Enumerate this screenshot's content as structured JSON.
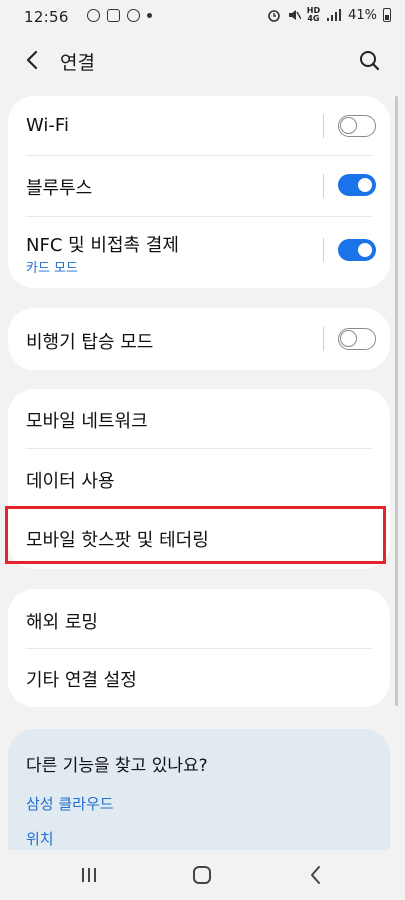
{
  "status_bar": {
    "time": "12:56",
    "battery_pct": "41%"
  },
  "header": {
    "title": "연결"
  },
  "group1": {
    "wifi": {
      "label": "Wi-Fi",
      "enabled": false
    },
    "bluetooth": {
      "label": "블루투스",
      "enabled": true
    },
    "nfc": {
      "label": "NFC 및 비접촉 결제",
      "sub": "카드 모드",
      "enabled": true
    }
  },
  "group2": {
    "airplane": {
      "label": "비행기 탑승 모드",
      "enabled": false
    }
  },
  "group3": {
    "mobile_network": "모바일 네트워크",
    "data_usage": "데이터 사용",
    "hotspot": "모바일 핫스팟 및 테더링"
  },
  "group4": {
    "roaming": "해외 로밍",
    "more_settings": "기타 연결 설정"
  },
  "help": {
    "title": "다른 기능을 찾고 있나요?",
    "links": [
      "삼성 클라우드",
      "위치"
    ]
  },
  "colors": {
    "accent": "#1a73e8",
    "highlight": "#e4232d",
    "help_bg": "#e1e9f1"
  }
}
